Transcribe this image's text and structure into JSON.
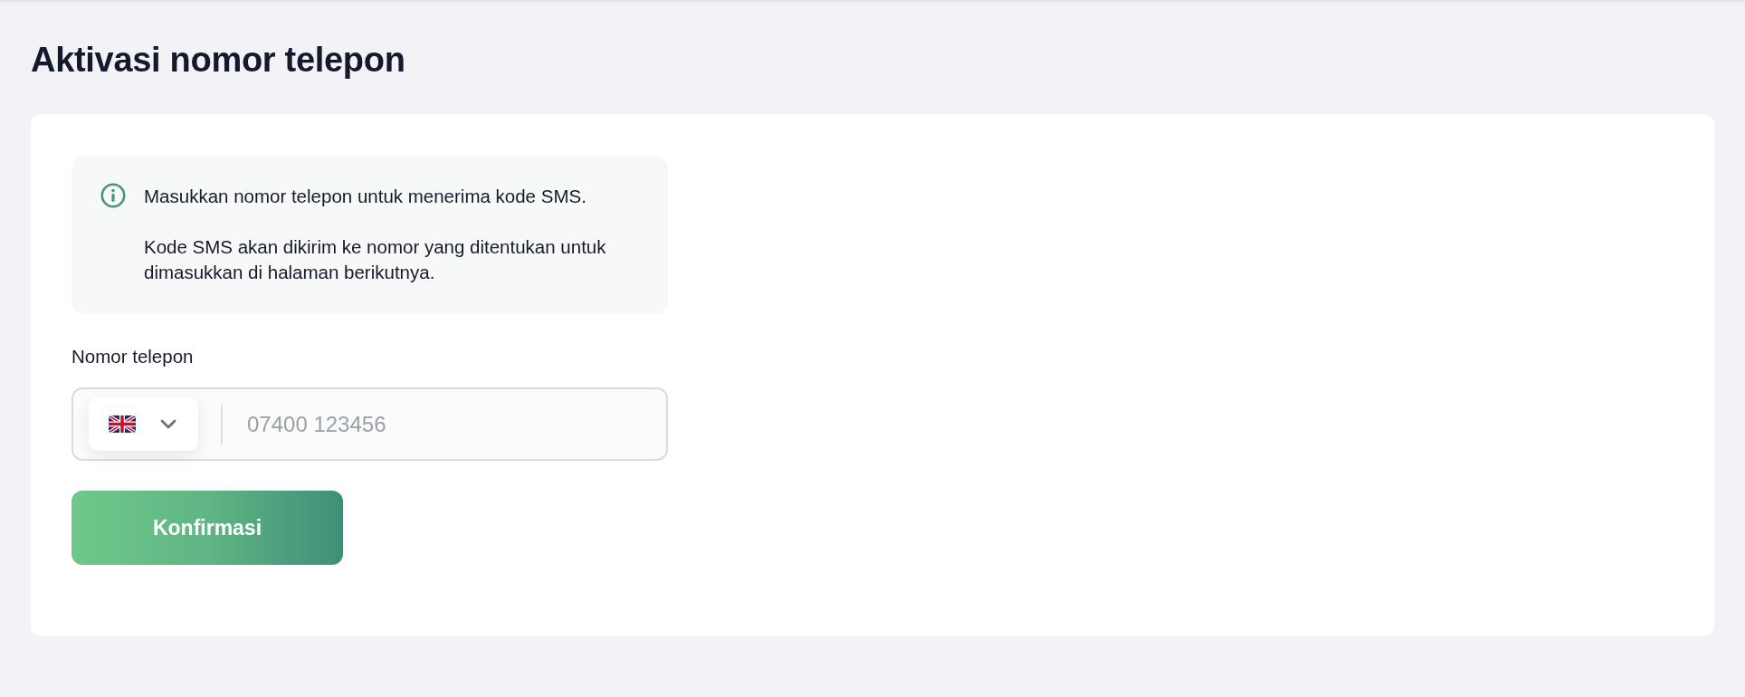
{
  "page": {
    "title": "Aktivasi nomor telepon"
  },
  "info": {
    "paragraphs": [
      "Masukkan nomor telepon untuk menerima kode SMS.",
      "Kode SMS akan dikirim ke nomor yang ditentukan untuk dimasukkan di halaman berikutnya."
    ]
  },
  "phone": {
    "label": "Nomor telepon",
    "placeholder": "07400 123456"
  },
  "confirm_button": {
    "label": "Konfirmasi"
  }
}
